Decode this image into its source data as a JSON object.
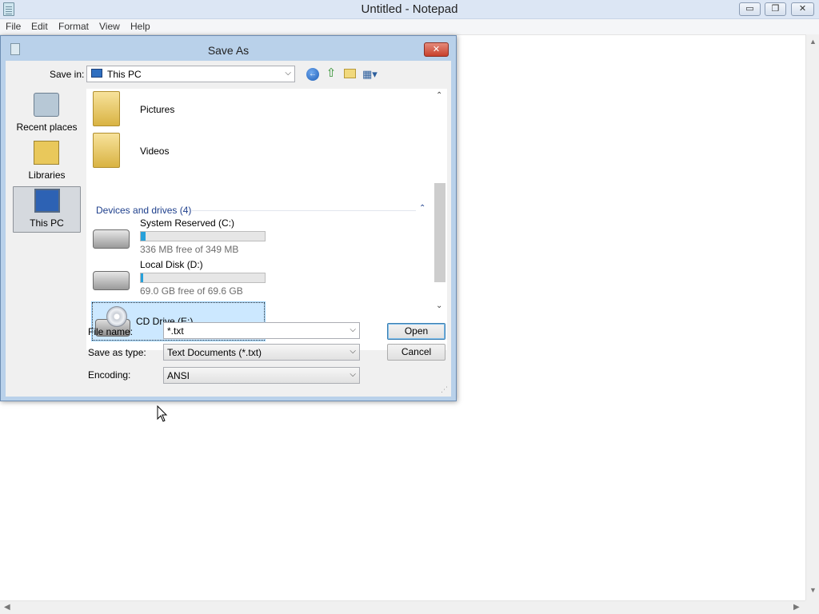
{
  "notepad": {
    "title": "Untitled - Notepad",
    "controls": {
      "minimize": "▭",
      "maximize": "❐",
      "close": "✕"
    },
    "menu": [
      "File",
      "Edit",
      "Format",
      "View",
      "Help"
    ],
    "scroll": {
      "up": "▲",
      "down": "▼",
      "left": "◀",
      "right": "▶"
    }
  },
  "dialog": {
    "title": "Save As",
    "close_label": "✕",
    "save_in": {
      "label": "Save in:",
      "value": "This PC",
      "chevron": "⌵"
    },
    "toolbar": {
      "back": "←",
      "up": "⇧",
      "views": "▦▾"
    },
    "places": [
      {
        "label": "Recent places",
        "icon": "recent-places-icon"
      },
      {
        "label": "Libraries",
        "icon": "libraries-icon"
      },
      {
        "label": "This PC",
        "icon": "this-pc-icon",
        "selected": true
      }
    ],
    "folders": [
      {
        "name": "Pictures",
        "icon": "folder-pictures-icon"
      },
      {
        "name": "Videos",
        "icon": "folder-videos-icon"
      }
    ],
    "group": {
      "header": "Devices and drives (4)",
      "collapse": "⌃"
    },
    "drives": [
      {
        "name": "System Reserved (C:)",
        "free_text": "336 MB free of 349 MB",
        "used_fraction": 0.037,
        "icon": "hard-drive-icon"
      },
      {
        "name": "Local Disk (D:)",
        "free_text": "69.0 GB free of 69.6 GB",
        "used_fraction": 0.009,
        "icon": "hard-drive-icon"
      },
      {
        "name": "CD Drive (E:)",
        "icon": "cd-drive-icon",
        "selected": true
      }
    ],
    "list_scroll": {
      "up": "⌃",
      "down": "⌄"
    },
    "file_name": {
      "label": "File name:",
      "value": "*.txt",
      "chevron": "⌵"
    },
    "save_as_type": {
      "label": "Save as type:",
      "value": "Text Documents (*.txt)",
      "chevron": "⌵"
    },
    "encoding": {
      "label": "Encoding:",
      "value": "ANSI",
      "chevron": "⌵"
    },
    "buttons": {
      "open": "Open",
      "cancel": "Cancel"
    },
    "grip": "⋰"
  },
  "colors": {
    "title_bar": "#dce6f4",
    "dialog_frame": "#b9d1ea",
    "selection": "#cce8ff",
    "drive_bar": "#26a0da",
    "close_button": "#c7402c"
  }
}
